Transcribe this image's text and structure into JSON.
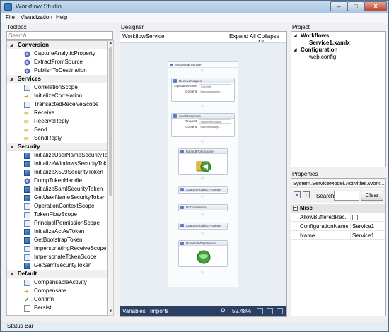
{
  "window": {
    "title": "Workflow Studio",
    "min_glyph": "–",
    "max_glyph": "□",
    "close_glyph": "X"
  },
  "menu": [
    "File",
    "Visualization",
    "Help"
  ],
  "toolbox": {
    "title": "Toolbox",
    "search_placeholder": "Search",
    "categories": [
      {
        "name": "Conversion",
        "items": [
          "CaptureAnalyticProperty",
          "ExtractFromSource",
          "PublishToDestination"
        ]
      },
      {
        "name": "Services",
        "items": [
          "CorrelationScope",
          "InitializeCorrelation",
          "TransactedReceiveScope",
          "Receive",
          "ReceiveReply",
          "Send",
          "SendReply"
        ]
      },
      {
        "name": "Security",
        "items": [
          "InitializeUserNameSecurityToken",
          "InitializeWindowsSecurityToken",
          "InitializeX509SecurityToken",
          "DumpTokenHandle",
          "InitializeSamlSecurityToken",
          "GetUserNameSecurityToken",
          "OperationContextScope",
          "TokenFlowScope",
          "PrincipalPermissionScope",
          "InitializeActAsToken",
          "GetBootstrapToken",
          "ImpersonatingReceiveScope",
          "ImpersonateTokenScope",
          "GetSamlSecurityToken"
        ]
      },
      {
        "name": "Default",
        "items": [
          "CompensableActivity",
          "Compensate",
          "Confirm",
          "Persist"
        ]
      }
    ]
  },
  "designer": {
    "title": "Designer",
    "breadcrumb": "WorkflowService",
    "expand_all": "Expand All",
    "collapse_all": "Collapse All",
    "sequence_title": "Sequential Service",
    "receive": {
      "title": "ReceiveRequest",
      "op_label": "OperationName",
      "op_value": "Convert",
      "content_label": "Content",
      "content_value": "View parameter..."
    },
    "send": {
      "title": "SendResponse",
      "req_label": "Request",
      "req_value": "ReceiveRequest",
      "content_label": "Content",
      "content_value": "View message..."
    },
    "activities": [
      "ExtractFromSource",
      "CaptureAnalyticProperty",
      "DoConversion",
      "CaptureAnalyticProperty",
      "PublishToDestination"
    ],
    "footer": {
      "variables": "Variables",
      "imports": "Imports",
      "zoom": "59.48%"
    }
  },
  "project": {
    "title": "Project",
    "workflows": "Workflows",
    "file1": "Service1.xamlx",
    "configuration": "Configuration",
    "file2": "web.config"
  },
  "properties": {
    "title": "Properties",
    "type": "System.ServiceModel.Activities.Work...",
    "search_label": "Search:",
    "clear_label": "Clear",
    "category": "Misc",
    "rows": [
      {
        "name": "AllowBufferedRec...",
        "value": ""
      },
      {
        "name": "ConfigurationName",
        "value": "Service1"
      },
      {
        "name": "Name",
        "value": "Service1"
      }
    ]
  },
  "status": "Status Bar"
}
